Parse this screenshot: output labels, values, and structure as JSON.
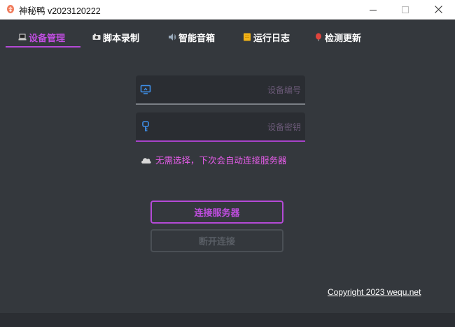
{
  "window": {
    "title": "神秘鸭 v2023120222"
  },
  "tabs": [
    {
      "label": "设备管理",
      "icon": "laptop-icon",
      "active": true
    },
    {
      "label": "脚本录制",
      "icon": "camera-icon",
      "active": false
    },
    {
      "label": "智能音箱",
      "icon": "speaker-icon",
      "active": false
    },
    {
      "label": "运行日志",
      "icon": "notepad-icon",
      "active": false
    },
    {
      "label": "检测更新",
      "icon": "balloon-icon",
      "active": false
    }
  ],
  "form": {
    "device_id_placeholder": "设备编号",
    "device_id_value": "",
    "device_key_placeholder": "设备密钥",
    "device_key_value": "",
    "hint": "无需选择，下次会自动连接服务器",
    "connect_label": "连接服务器",
    "disconnect_label": "断开连接"
  },
  "footer": {
    "copyright": "Copyright 2023 wequ.net"
  },
  "colors": {
    "accent": "#b44ad6",
    "background": "#34383d",
    "field_bg": "#2a2d32",
    "hint": "#e45ce8"
  }
}
